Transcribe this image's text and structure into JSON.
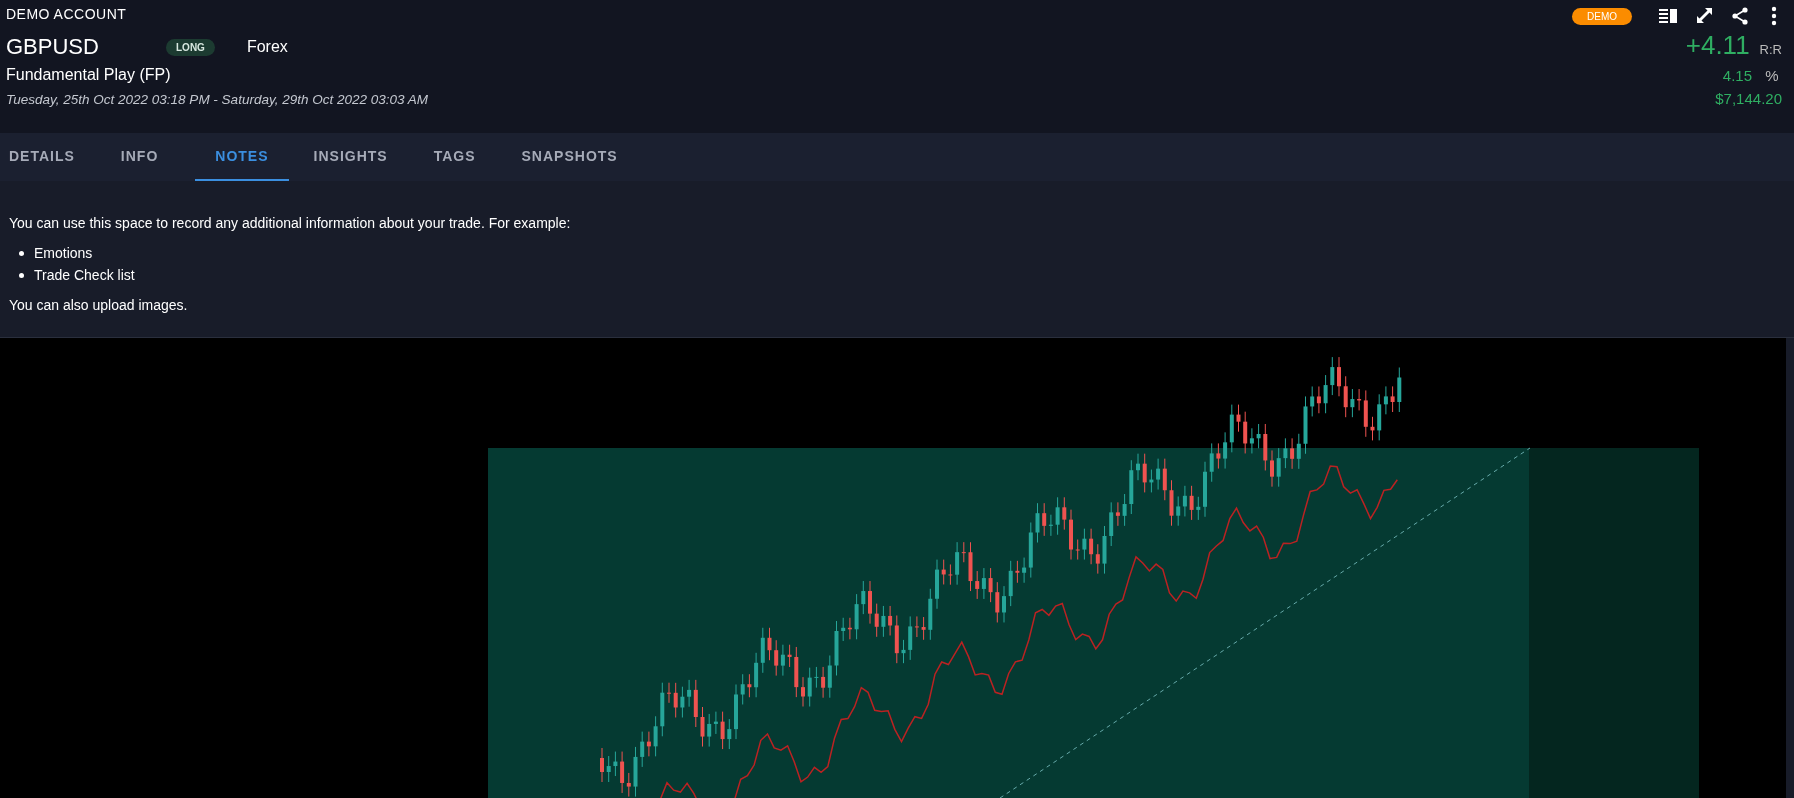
{
  "account": {
    "title": "DEMO ACCOUNT",
    "badge": "DEMO"
  },
  "trade": {
    "symbol": "GBPUSD",
    "direction": "LONG",
    "market": "Forex",
    "strategy": "Fundamental Play (FP)",
    "period": "Tuesday, 25th Oct 2022 03:18 PM - Saturday, 29th Oct 2022 03:03 AM"
  },
  "stats": [
    {
      "value": "+4.11",
      "unit": "R:R",
      "kind": "large"
    },
    {
      "value": "4.15",
      "unit": "%",
      "kind": "small"
    },
    {
      "value": "$7,144.20",
      "kind": "small"
    }
  ],
  "tabs": [
    {
      "label": "DETAILS",
      "selected": false
    },
    {
      "label": "INFO",
      "selected": false
    },
    {
      "label": "NOTES",
      "selected": true
    },
    {
      "label": "INSIGHTS",
      "selected": false
    },
    {
      "label": "TAGS",
      "selected": false
    },
    {
      "label": "SNAPSHOTS",
      "selected": false
    }
  ],
  "notes": {
    "intro": "You can use this space to record any additional information about your trade. For example:",
    "items": [
      "Emotions",
      "Trade Check list"
    ],
    "outro": "You can also upload images."
  }
}
